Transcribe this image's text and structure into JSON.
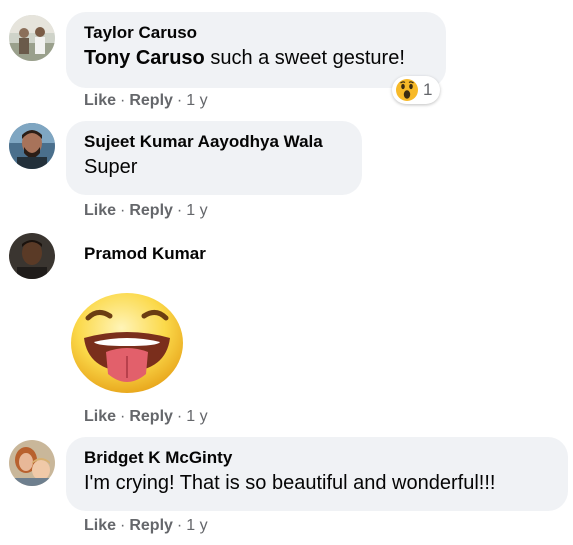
{
  "comments": [
    {
      "author": "Taylor Caruso",
      "tag": "Tony Caruso",
      "text": " such a sweet gesture!",
      "like_label": "Like",
      "reply_label": "Reply",
      "separator": "·",
      "age": "1 y",
      "reaction": {
        "icon": "wow-emoji-icon",
        "count": "1"
      }
    },
    {
      "author": "Sujeet Kumar Aayodhya Wala",
      "text": "Super",
      "like_label": "Like",
      "reply_label": "Reply",
      "separator": "·",
      "age": "1 y"
    },
    {
      "author": "Pramod Kumar",
      "sticker": "tongue-out-face-sticker",
      "like_label": "Like",
      "reply_label": "Reply",
      "separator": "·",
      "age": "1 y"
    },
    {
      "author": "Bridget K McGinty",
      "text": "I'm crying! That is so beautiful and wonderful!!!",
      "like_label": "Like",
      "reply_label": "Reply",
      "separator": "·",
      "age": "1 y"
    }
  ],
  "colors": {
    "bubble": "#f0f2f5",
    "meta_text": "#65676b",
    "name_text": "#050505"
  }
}
